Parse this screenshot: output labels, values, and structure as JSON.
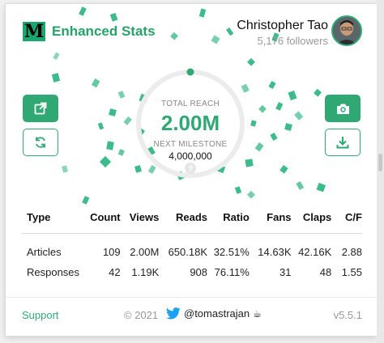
{
  "brand": {
    "logo_letter": "M",
    "name": "Enhanced Stats",
    "accent_color": "#2fa873"
  },
  "user": {
    "name": "Christopher Tao",
    "followers": "5,176 followers"
  },
  "actions": {
    "open_icon": "external-link-icon",
    "refresh_icon": "refresh-icon",
    "screenshot_icon": "camera-icon",
    "download_icon": "download-icon"
  },
  "reach": {
    "label": "TOTAL REACH",
    "value": "2.00M",
    "milestone_label": "NEXT MILESTONE",
    "milestone_value": "4,000,000",
    "progress_fraction": 0.5,
    "help_icon": "question-icon"
  },
  "table": {
    "headers": [
      "Type",
      "Count",
      "Views",
      "Reads",
      "Ratio",
      "Fans",
      "Claps",
      "C/F"
    ],
    "rows": [
      [
        "Articles",
        "109",
        "2.00M",
        "650.18K",
        "32.51%",
        "14.63K",
        "42.16K",
        "2.88"
      ],
      [
        "Responses",
        "42",
        "1.19K",
        "908",
        "76.11%",
        "31",
        "48",
        "1.55"
      ]
    ]
  },
  "footer": {
    "support": "Support",
    "copyright": "© 2021",
    "twitter_handle": "@tomastrajan",
    "coffee_emoji": "☕",
    "version": "v5.5.1"
  }
}
